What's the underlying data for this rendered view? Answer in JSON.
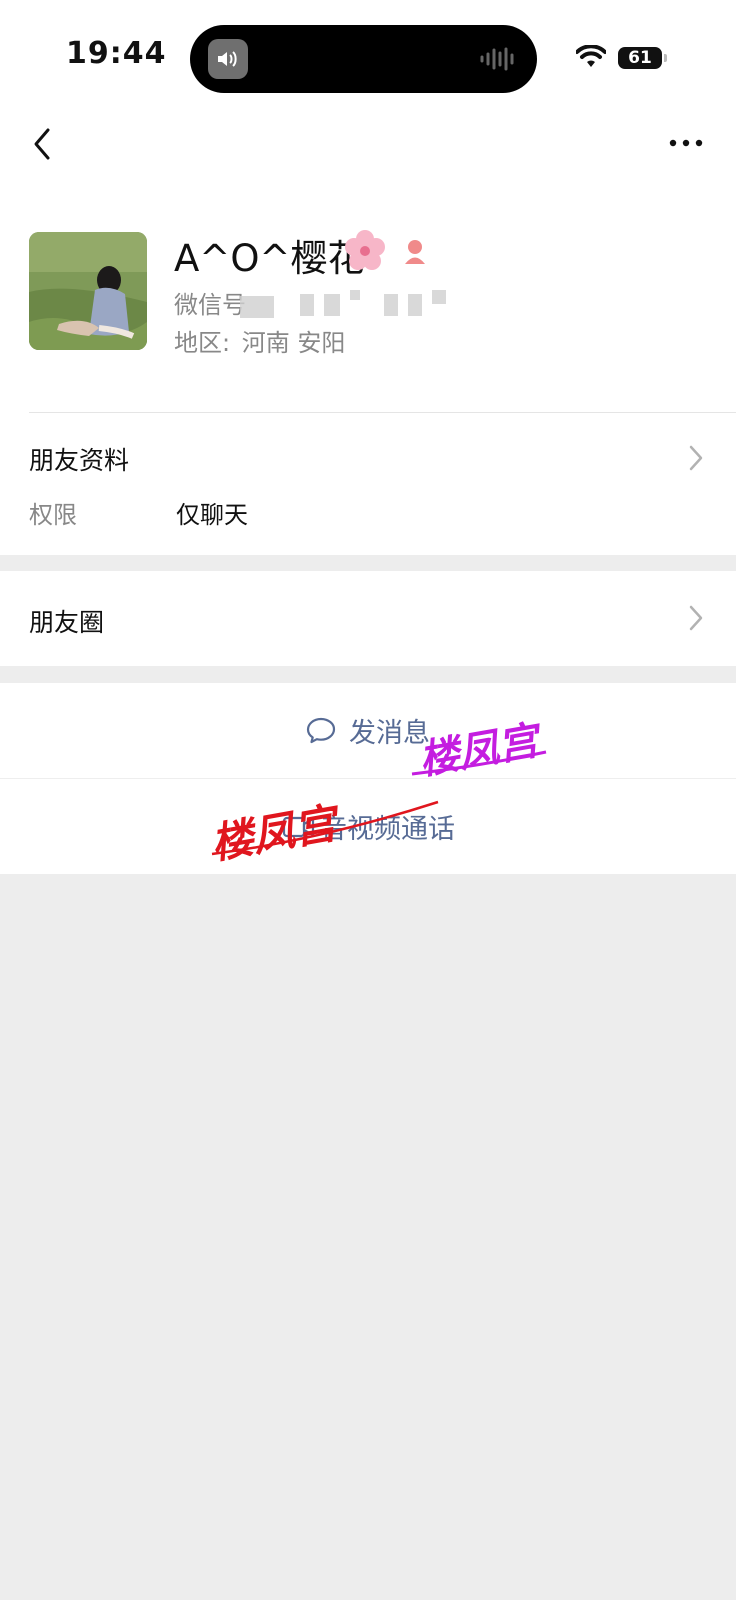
{
  "status_bar": {
    "time": "19:44",
    "battery": "61"
  },
  "nav": {
    "back_icon": "chevron-left-icon",
    "more_icon": "more-dots-icon"
  },
  "profile": {
    "name": "A^O^樱花",
    "name_emoji": "cherry-blossom-icon",
    "gender_icon": "female-icon",
    "wechat_id_label": "微信号",
    "region_label": "地区:",
    "region_value": "河南 安阳"
  },
  "friend_info": {
    "title": "朋友资料",
    "permission_label": "权限",
    "permission_value": "仅聊天"
  },
  "moments": {
    "title": "朋友圈"
  },
  "actions": {
    "message_label": "发消息",
    "call_label": "音视频通话",
    "accent_color": "#576b95"
  },
  "watermarks": {
    "red_text": "楼凤宫",
    "purple_text": "楼凤宫",
    "red_color": "#e0161e",
    "purple_color": "#c41de0"
  }
}
